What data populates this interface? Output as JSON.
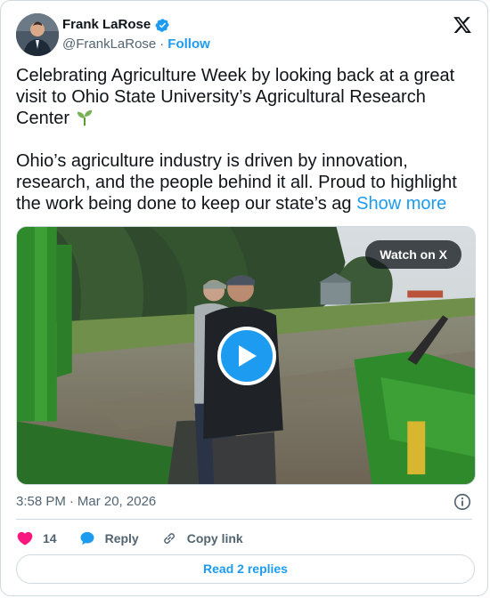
{
  "author": {
    "name": "Frank LaRose",
    "handle": "@FrankLaRose",
    "separator": "·",
    "follow_label": "Follow"
  },
  "tweet": {
    "paragraph1": "Celebrating Agriculture Week by looking back at a great visit to Ohio State University’s Agricultural Research Center",
    "paragraph2": "Ohio’s agriculture industry is driven by innovation, research, and the people behind it all. Proud to highlight the work being done to keep our state’s ag",
    "show_more": "Show more"
  },
  "media": {
    "watch_label": "Watch on X"
  },
  "meta": {
    "time": "3:58 PM",
    "separator": "·",
    "date": "Mar 20, 2026"
  },
  "actions": {
    "likes": "14",
    "reply_label": "Reply",
    "copy_link_label": "Copy link"
  },
  "replies_button": "Read 2 replies",
  "colors": {
    "accent": "#1d9bf0",
    "like": "#f91880",
    "text": "#0f1419",
    "muted": "#536471",
    "border": "#cfd9de"
  }
}
